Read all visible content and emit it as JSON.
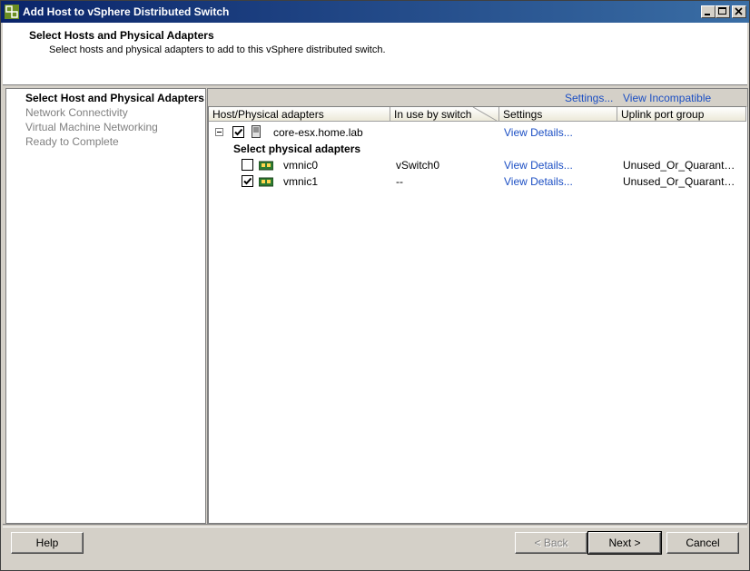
{
  "window": {
    "title": "Add Host to vSphere Distributed Switch"
  },
  "header": {
    "title": "Select Hosts and Physical Adapters",
    "subtitle": "Select hosts and physical adapters to add to this vSphere distributed switch."
  },
  "nav": {
    "items": [
      {
        "label": "Select Host and Physical Adapters"
      },
      {
        "label": "Network Connectivity"
      },
      {
        "label": "Virtual Machine Networking"
      },
      {
        "label": "Ready to Complete"
      }
    ]
  },
  "links": {
    "settings": "Settings...",
    "incompatible": "View Incompatible Hosts..."
  },
  "grid": {
    "columns": [
      "Host/Physical adapters",
      "In use by switch",
      "Settings",
      "Uplink port group"
    ],
    "host": {
      "name": "core-esx.home.lab",
      "checked": true,
      "settings": "View Details..."
    },
    "group_label": "Select physical adapters",
    "adapters": [
      {
        "name": "vmnic0",
        "in_use": "vSwitch0",
        "settings": "View Details...",
        "uplink": "Unused_Or_Quarantined_Uplinks",
        "checked": false
      },
      {
        "name": "vmnic1",
        "in_use": "--",
        "settings": "View Details...",
        "uplink": "Unused_Or_Quarantined_Uplinks",
        "checked": true
      }
    ]
  },
  "buttons": {
    "help": "Help",
    "back": "< Back",
    "next": "Next >",
    "cancel": "Cancel"
  }
}
